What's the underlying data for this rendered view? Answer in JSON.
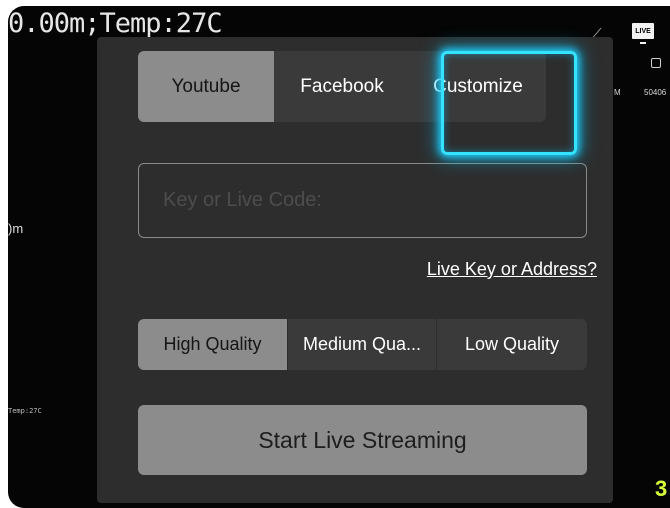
{
  "hud": {
    "top_readout": "0.00m;Temp:27C",
    "left_mid": ")m",
    "left_small": "Temp:27C",
    "right_label_m": "M",
    "right_label_num": "50406",
    "live_badge": "LIVE"
  },
  "platforms": [
    {
      "label": "Youtube",
      "selected": true
    },
    {
      "label": "Facebook",
      "selected": false
    },
    {
      "label": "Customize",
      "selected": false
    }
  ],
  "key_input": {
    "placeholder": "Key or Live Code:",
    "value": ""
  },
  "help_link": "Live Key or Address?",
  "quality_options": [
    {
      "label": "High Quality",
      "selected": true
    },
    {
      "label": "Medium Qua...",
      "selected": false
    },
    {
      "label": "Low Quality",
      "selected": false
    }
  ],
  "start_button": "Start Live Streaming",
  "colors": {
    "highlight": "#33e3ff",
    "selected": "#8c8c8c",
    "panel": "#2d2d2d"
  }
}
